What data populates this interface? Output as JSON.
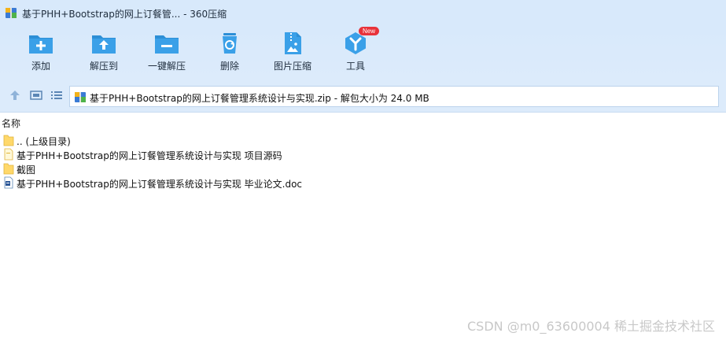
{
  "window": {
    "title": "基于PHH+Bootstrap的网上订餐管... - 360压缩"
  },
  "toolbar": {
    "items": [
      {
        "label": "添加",
        "icon": "add-folder-icon"
      },
      {
        "label": "解压到",
        "icon": "extract-to-folder-icon"
      },
      {
        "label": "一键解压",
        "icon": "one-click-extract-icon"
      },
      {
        "label": "删除",
        "icon": "recycle-bin-icon"
      },
      {
        "label": "图片压缩",
        "icon": "image-compress-icon"
      },
      {
        "label": "工具",
        "icon": "tools-icon",
        "badge": "New"
      }
    ]
  },
  "addressbar": {
    "nav_icons": [
      "up-arrow-icon",
      "thumbnail-view-icon",
      "list-view-icon"
    ],
    "path": "基于PHH+Bootstrap的网上订餐管理系统设计与实现.zip - 解包大小为 24.0 MB"
  },
  "filelist": {
    "column_name": "名称",
    "rows": [
      {
        "name": ".. (上级目录)",
        "type": "folder"
      },
      {
        "name": "基于PHH+Bootstrap的网上订餐管理系统设计与实现 项目源码",
        "type": "file"
      },
      {
        "name": "截图",
        "type": "folder"
      },
      {
        "name": "基于PHH+Bootstrap的网上订餐管理系统设计与实现 毕业论文.doc",
        "type": "doc"
      }
    ]
  },
  "watermark": "CSDN @m0_63600004 稀土掘金技术社区",
  "colors": {
    "toolbar_bg": "#d8e9fb",
    "icon_blue": "#2d8fd6",
    "folder_yellow": "#ffd86a",
    "badge_red": "#e8323a"
  }
}
